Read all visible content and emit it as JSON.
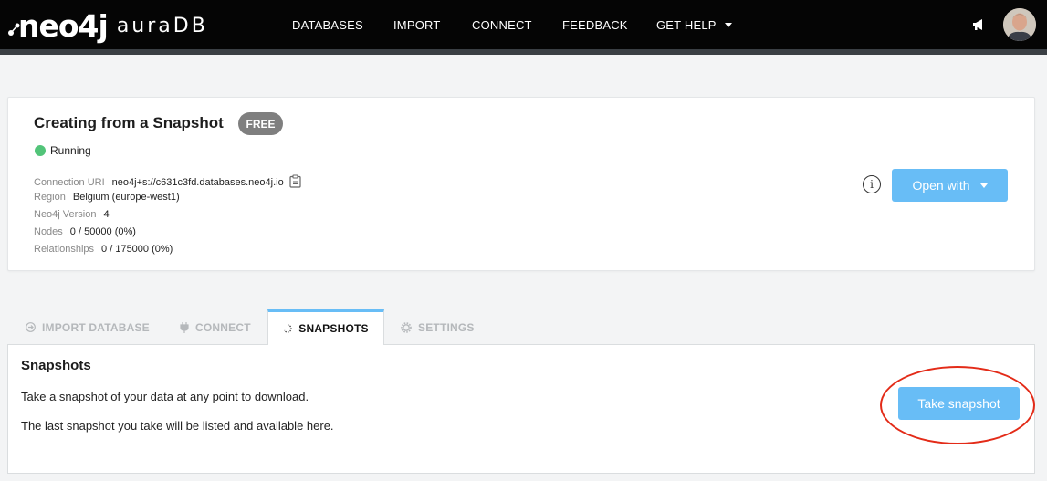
{
  "header": {
    "logo_text": "neo4j",
    "logo_product": "auraDB",
    "nav": [
      {
        "label": "DATABASES"
      },
      {
        "label": "IMPORT"
      },
      {
        "label": "CONNECT"
      },
      {
        "label": "FEEDBACK"
      },
      {
        "label": "GET HELP"
      }
    ],
    "icons": [
      "megaphone-icon",
      "user-avatar"
    ]
  },
  "database": {
    "name": "Creating from a Snapshot",
    "tier": "FREE",
    "status": "Running",
    "status_color": "#52c479",
    "details": [
      {
        "label": "Connection URI",
        "value": "neo4j+s://c631c3fd.databases.neo4j.io"
      },
      {
        "label": "Region",
        "value": "Belgium (europe-west1)"
      },
      {
        "label": "Neo4j Version",
        "value": "4"
      },
      {
        "label": "Nodes",
        "value": "0 / 50000 (0%)"
      },
      {
        "label": "Relationships",
        "value": "0 / 175000 (0%)"
      }
    ],
    "open_with_label": "Open with"
  },
  "tabs": [
    {
      "label": "IMPORT DATABASE",
      "icon": "import-icon",
      "active": false
    },
    {
      "label": "CONNECT",
      "icon": "plug-icon",
      "active": false
    },
    {
      "label": "SNAPSHOTS",
      "icon": "spinner-icon",
      "active": true
    },
    {
      "label": "SETTINGS",
      "icon": "gear-icon",
      "active": false
    }
  ],
  "snapshots_panel": {
    "title": "Snapshots",
    "line1": "Take a snapshot of your data at any point to download.",
    "line2": "The last snapshot you take will be listed and available here.",
    "button_label": "Take snapshot"
  },
  "colors": {
    "accent": "#68bdf6",
    "topbar": "#050505",
    "badge": "#7f7f7f",
    "highlight": "#e32b18"
  }
}
